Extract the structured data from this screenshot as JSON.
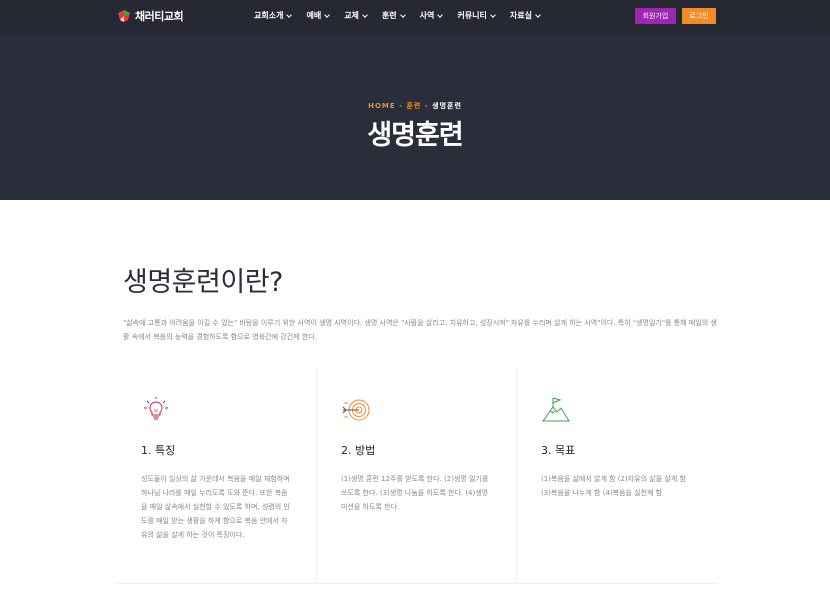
{
  "header": {
    "logo_text": "채러티교회",
    "nav": [
      {
        "label": "교회소개"
      },
      {
        "label": "예배"
      },
      {
        "label": "교제"
      },
      {
        "label": "훈련"
      },
      {
        "label": "사역"
      },
      {
        "label": "커뮤니티"
      },
      {
        "label": "자료실"
      }
    ],
    "join_label": "회원가입",
    "login_label": "로그인"
  },
  "hero": {
    "breadcrumb": {
      "home": "HOME",
      "sep": "-",
      "training": "훈련",
      "current": "생명훈련"
    },
    "title": "생명훈련"
  },
  "main": {
    "section_title": "생명훈련이란?",
    "intro": "\"삶속에 고통과 어려움을 이길 수 있는\" 바탕을 이루기 위한 사역이 생명 사역이다. 생명 사역은 \"사람을 살리고, 치유하고, 성장시켜\" 자유를 누리며 살게 하는 사역\"이다. 특히 \"생명일기\"를 통해 매일의 생활 속에서 복음의 능력을 경험하도록 함으로 영육간에 강건케 한다.",
    "cards": [
      {
        "icon": "lightbulb-icon",
        "title": "1. 특징",
        "text": "성도들이 일상의 삶 가운데서 복음을 매일 체험하며 하나님 나라를 매일 누리도록 도와 준다. 또한 복음을 매일 삶속에서 실천할 수 있도록 하며, 성령의 인도를 매일 받는 생활을 하게 함으로 복음 안에서 자유의 삶을 살게 하는 것이 특징이다."
      },
      {
        "icon": "target-icon",
        "title": "2. 방법",
        "text": "(1)생명 훈련 12주를 받도록 한다. (2)생명 일기를 쓰도록 한다. (3)생명 나눔을 하도록 한다. (4)생명 미션을 하도록 한다."
      },
      {
        "icon": "mountain-flag-icon",
        "title": "3. 목표",
        "text": "(1)복음을 삶에서 알게 함 (2)자유의 삶을 살게 함 (3)복음을 나누게 함 (4)복음을 실천케 함"
      }
    ]
  },
  "colors": {
    "hero_bg": "#2a2d3a",
    "accent_orange": "#f28c28",
    "accent_purple": "#9c27b0"
  }
}
